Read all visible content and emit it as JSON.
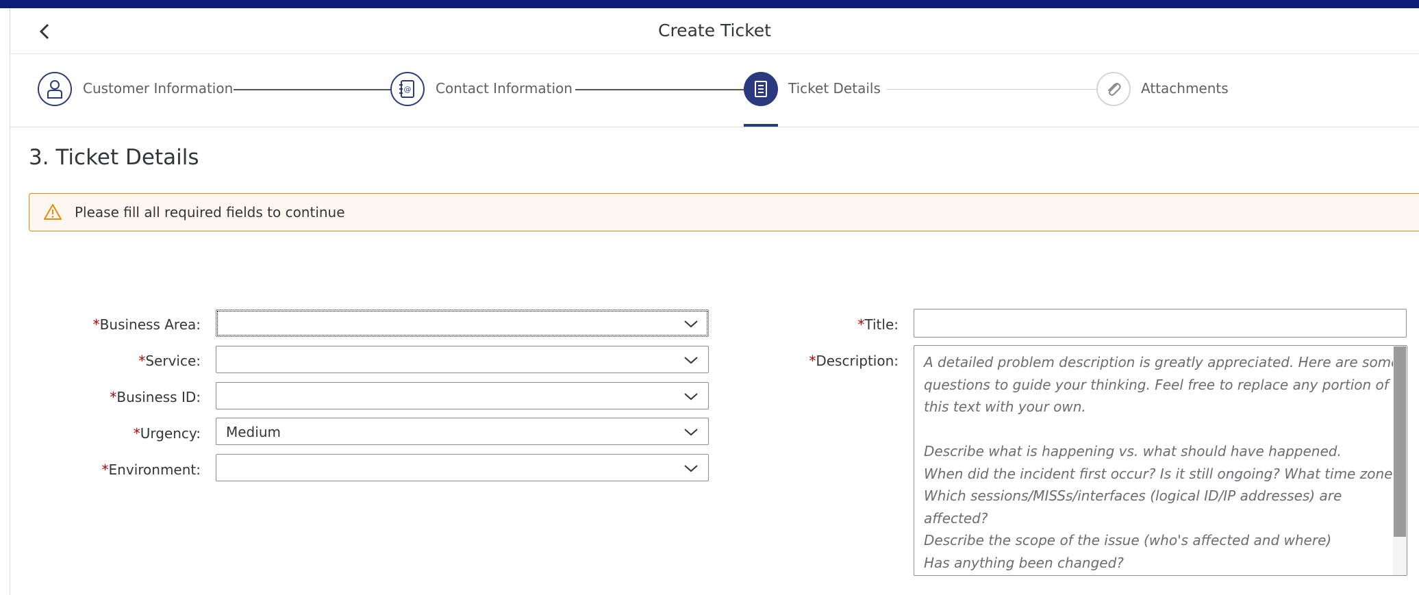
{
  "header": {
    "title": "Create Ticket",
    "back_icon": "chevron-left-icon"
  },
  "steps": [
    {
      "label": "Customer Information",
      "icon": "person-icon",
      "state": "done"
    },
    {
      "label": "Contact Information",
      "icon": "address-book-icon",
      "state": "done"
    },
    {
      "label": "Ticket Details",
      "icon": "document-icon",
      "state": "active"
    },
    {
      "label": "Attachments",
      "icon": "paperclip-icon",
      "state": "todo"
    }
  ],
  "section": {
    "title": "3. Ticket Details"
  },
  "warning": {
    "text": "Please fill all required fields to continue",
    "icon": "warning-icon",
    "color": "#e78c07"
  },
  "form": {
    "required_mark": "*",
    "business_area": {
      "label": "Business Area:",
      "value": ""
    },
    "service": {
      "label": "Service:",
      "value": ""
    },
    "business_id": {
      "label": "Business ID:",
      "value": ""
    },
    "urgency": {
      "label": "Urgency:",
      "value": "Medium"
    },
    "environment": {
      "label": "Environment:",
      "value": ""
    },
    "title": {
      "label": "Title:",
      "value": ""
    },
    "description": {
      "label": "Description:",
      "lines": [
        "A detailed problem description is greatly appreciated. Here are some",
        "questions to guide your thinking. Feel free to replace any portion of",
        "this text with your own.",
        "",
        " Describe what is happening vs. what should have happened.",
        " When did the incident first occur? Is it still ongoing? What time zone?",
        " Which sessions/MISSs/interfaces (logical ID/IP addresses) are",
        "affected?",
        " Describe the scope of the issue (who's affected and where)",
        " Has anything been changed?"
      ]
    }
  },
  "colors": {
    "accent": "#2b3a7e",
    "topbar": "#0a1e78",
    "required": "#bb0000",
    "warning_bg": "#fef7f1"
  }
}
